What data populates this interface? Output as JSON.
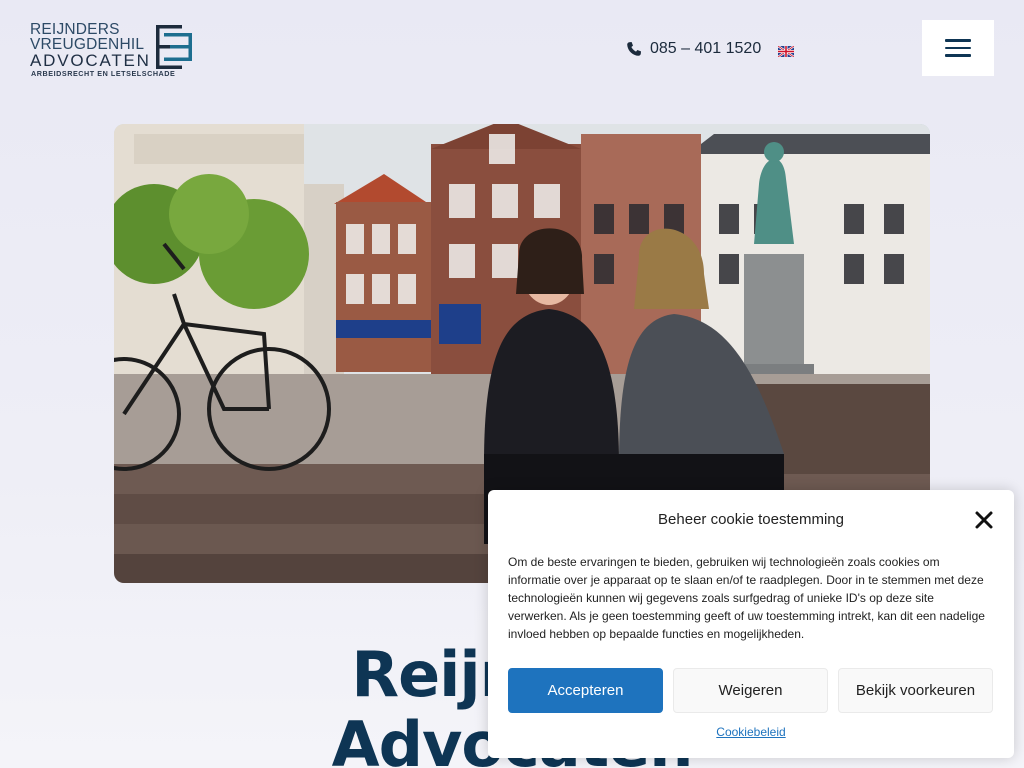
{
  "header": {
    "logo": {
      "line1": "REIJNDERS",
      "line2": "VREUGDENHIL",
      "line3": "ADVOCATEN",
      "tagline": "ARBEIDSRECHT EN LETSELSCHADE"
    },
    "phone": "085 – 401 1520",
    "language_flag": "uk-flag-icon",
    "menu_icon": "hamburger-icon"
  },
  "hero": {
    "image": "photo-two-lawyers-on-town-square-steps"
  },
  "headline": {
    "line1": "Reijnders",
    "line2": "Advocaten"
  },
  "cookie": {
    "title": "Beheer cookie toestemming",
    "body": "Om de beste ervaringen te bieden, gebruiken wij technologieën zoals cookies om informatie over je apparaat op te slaan en/of te raadplegen. Door in te stemmen met deze technologieën kunnen wij gegevens zoals surfgedrag of unieke ID's op deze site verwerken. Als je geen toestemming geeft of uw toestemming intrekt, kan dit een nadelige invloed hebben op bepaalde functies en mogelijkheden.",
    "accept_label": "Accepteren",
    "deny_label": "Weigeren",
    "prefs_label": "Bekijk voorkeuren",
    "policy_link": "Cookiebeleid",
    "accent_color": "#1e73be"
  }
}
